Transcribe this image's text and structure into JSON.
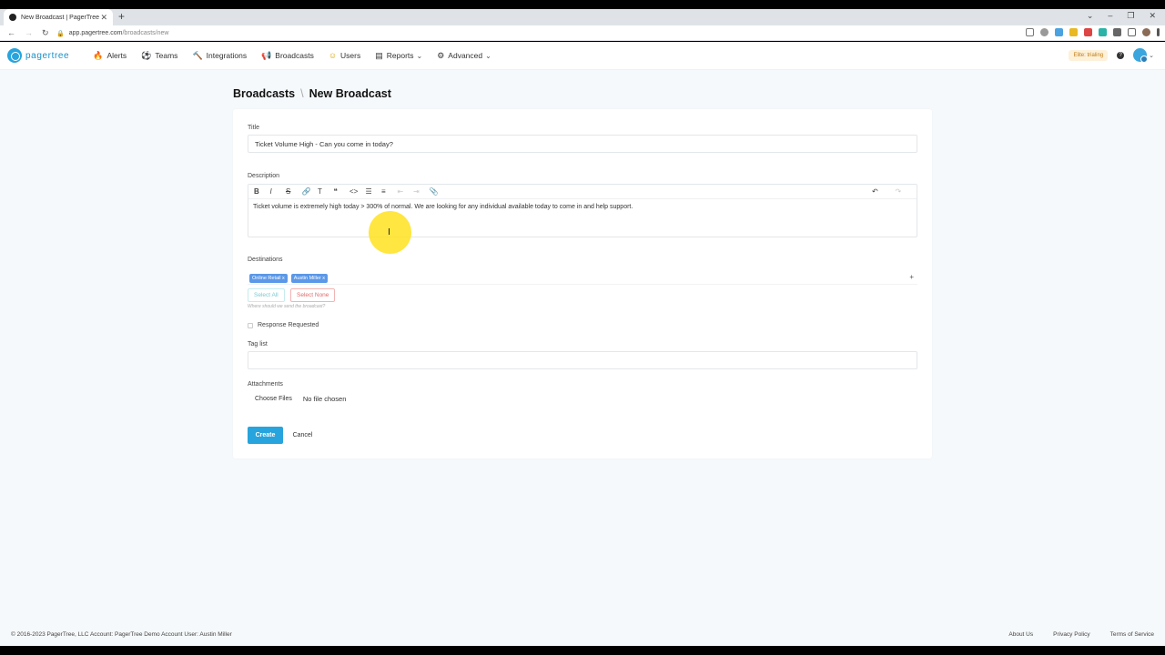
{
  "browser": {
    "tab_title": "New Broadcast | PagerTree",
    "url_host": "app.pagertree.com",
    "url_path": "/broadcasts/new",
    "controls": {
      "minimize": "–",
      "restore": "❐",
      "close": "✕",
      "tab_close": "✕",
      "new_tab": "+",
      "dropdown": "⌄"
    },
    "nav": {
      "back": "←",
      "forward": "→",
      "reload": "↻"
    }
  },
  "nav": {
    "brand": "pagertree",
    "items": [
      {
        "label": "Alerts",
        "icon": "flame-icon",
        "glyph": "🔥"
      },
      {
        "label": "Teams",
        "icon": "soccer-ball-icon",
        "glyph": "⚽"
      },
      {
        "label": "Integrations",
        "icon": "hammer-icon",
        "glyph": "🔨"
      },
      {
        "label": "Broadcasts",
        "icon": "megaphone-icon",
        "glyph": "📢"
      },
      {
        "label": "Users",
        "icon": "smiley-icon",
        "glyph": "☺"
      },
      {
        "label": "Reports",
        "icon": "chart-icon",
        "glyph": "▤",
        "chevron": "⌄"
      },
      {
        "label": "Advanced",
        "icon": "advanced-icon",
        "glyph": "⚙",
        "chevron": "⌄"
      }
    ],
    "trial_badge": "Elite: trialing",
    "help": "?",
    "avatar_chevron": "⌄"
  },
  "breadcrumb": {
    "parent": "Broadcasts",
    "separator": "\\",
    "current": "New Broadcast"
  },
  "form": {
    "title_label": "Title",
    "title_value": "Ticket Volume High - Can you come in today?",
    "description_label": "Description",
    "toolbar": [
      "B",
      "I",
      "S",
      "🔗",
      "T",
      "❝",
      "<>",
      "☰",
      "≡",
      "⇤",
      "⇥",
      "📎"
    ],
    "toolbar_undo": "↶",
    "toolbar_redo": "↷",
    "description_value": "Ticket volume is extremely high today > 300% of normal. We are looking for any individual available today to come in and help support.",
    "destinations_label": "Destinations",
    "destinations": [
      "Online Retail x",
      "Austin Miller x"
    ],
    "destinations_add": "+",
    "select_all": "Select All",
    "select_none": "Select None",
    "destinations_help": "Where should we send the broadcast?",
    "response_requested_label": "Response Requested",
    "tag_list_label": "Tag list",
    "tag_list_value": "",
    "attachments_label": "Attachments",
    "choose_files": "Choose Files",
    "no_file": "No file chosen",
    "create": "Create",
    "cancel": "Cancel"
  },
  "footer": {
    "copyright": "© 2016-2023 PagerTree, LLC  Account: PagerTree Demo Account  User: Austin Miller",
    "links": [
      "About Us",
      "Privacy Policy",
      "Terms of Service"
    ]
  },
  "colors": {
    "brand": "#27a4dd",
    "chip": "#5b98e8",
    "danger": "#e06b6b",
    "highlight": "#ffe21e"
  }
}
